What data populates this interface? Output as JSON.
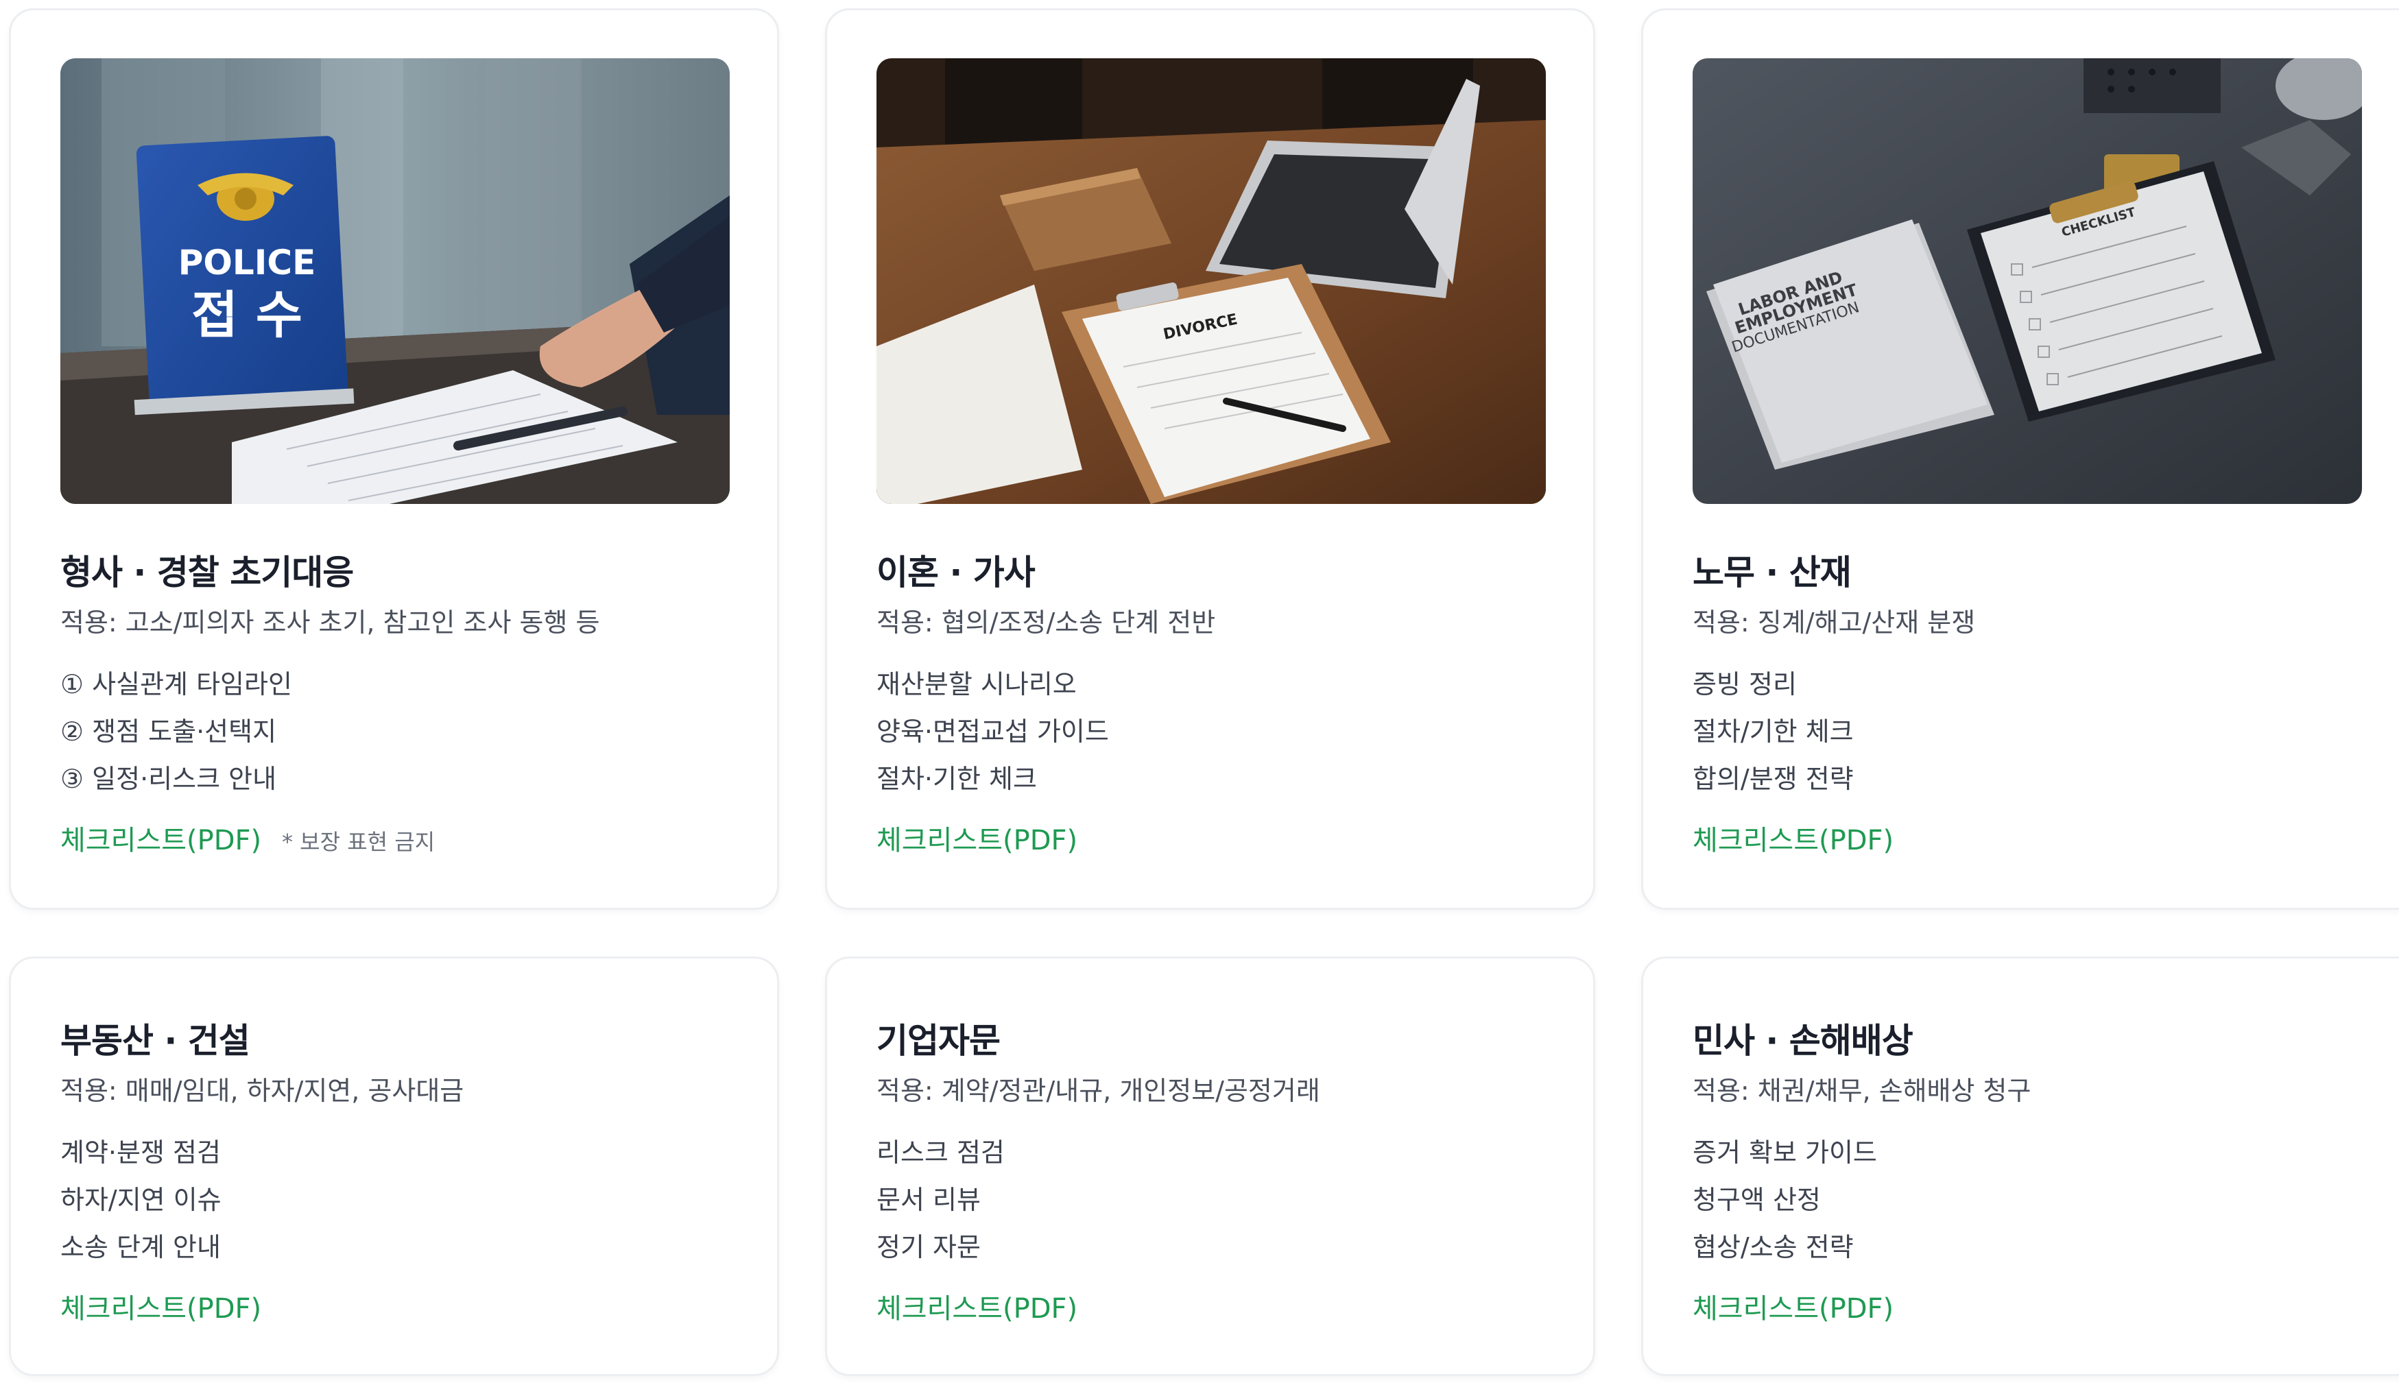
{
  "cards": [
    {
      "title": "형사 · 경찰 초기대응",
      "scope": "적용: 고소/피의자 조사 초기, 참고인 조사 동행 등",
      "items": [
        "① 사실관계 타임라인",
        "② 쟁점 도출·선택지",
        "③ 일정·리스크 안내"
      ],
      "link": "체크리스트(PDF)",
      "note": "* 보장 표현 금지",
      "photo": {
        "sign_top": "POLICE",
        "sign_bottom": "접 수"
      }
    },
    {
      "title": "이혼 · 가사",
      "scope": "적용: 협의/조정/소송 단계 전반",
      "items": [
        "재산분할 시나리오",
        "양육·면접교섭 가이드",
        "절차·기한 체크"
      ],
      "link": "체크리스트(PDF)",
      "photo": {
        "doc_label": "DIVORCE"
      }
    },
    {
      "title": "노무 · 산재",
      "scope": "적용: 징계/해고/산재 분쟁",
      "items": [
        "증빙 정리",
        "절차/기한 체크",
        "합의/분쟁 전략"
      ],
      "link": "체크리스트(PDF)",
      "photo": {
        "doc_line1": "LABOR AND",
        "doc_line2": "EMPLOYMENT",
        "doc_line3": "DOCUMENTATION",
        "checklist": "CHECKLIST"
      }
    },
    {
      "title": "부동산 · 건설",
      "scope": "적용: 매매/임대, 하자/지연, 공사대금",
      "items": [
        "계약·분쟁 점검",
        "하자/지연 이슈",
        "소송 단계 안내"
      ],
      "link": "체크리스트(PDF)"
    },
    {
      "title": "기업자문",
      "scope": "적용: 계약/정관/내규, 개인정보/공정거래",
      "items": [
        "리스크 점검",
        "문서 리뷰",
        "정기 자문"
      ],
      "link": "체크리스트(PDF)"
    },
    {
      "title": "민사 · 손해배상",
      "scope": "적용: 채권/채무, 손해배상 청구",
      "items": [
        "증거 확보 가이드",
        "청구액 산정",
        "협상/소송 전략"
      ],
      "link": "체크리스트(PDF)"
    }
  ],
  "colors": {
    "link": "#1e9a52",
    "title": "#1a1f2b",
    "border": "#eceef1"
  },
  "icons": [
    "police-badge-icon"
  ]
}
